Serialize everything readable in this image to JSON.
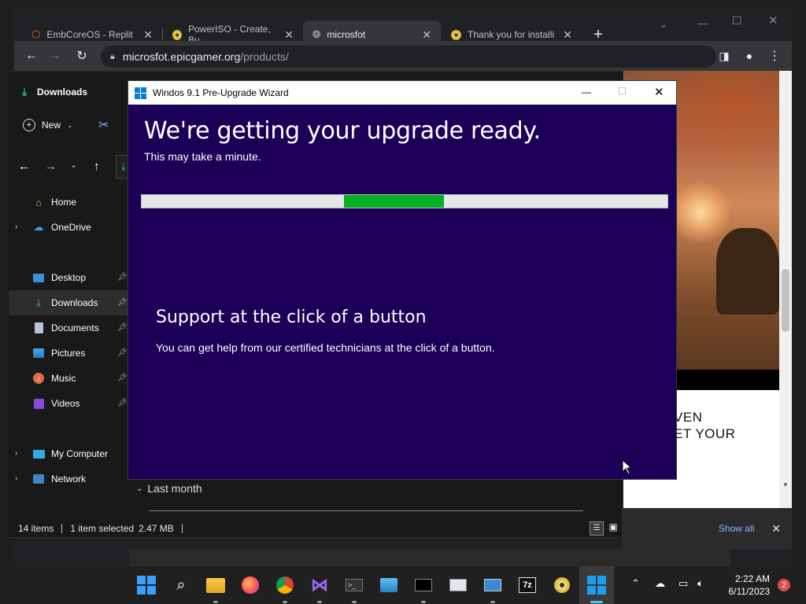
{
  "browser": {
    "tabs": [
      {
        "label": "EmbCoreOS - Replit",
        "icon": "replit-icon"
      },
      {
        "label": "PowerISO - Create, Bu",
        "icon": "poweriso-icon"
      },
      {
        "label": "microsfot",
        "icon": "globe-icon"
      },
      {
        "label": "Thank you for installi",
        "icon": "poweriso-icon"
      }
    ],
    "active_tab_index": 2,
    "new_tab_symbol": "+",
    "url_domain": "microsfot.epicgamer.org",
    "url_path": "/products/",
    "page_text_line1": "VEN",
    "page_text_line2": "ET YOUR"
  },
  "explorer": {
    "header_title": "Downloads",
    "new_label": "New",
    "nav": [
      {
        "label": "Home",
        "icon": "home-icon",
        "expandable": false,
        "pinned": false
      },
      {
        "label": "OneDrive",
        "icon": "cloud-icon",
        "expandable": true,
        "pinned": false
      },
      {
        "label": "Desktop",
        "icon": "desktop-icon",
        "expandable": false,
        "pinned": true
      },
      {
        "label": "Downloads",
        "icon": "download-icon",
        "expandable": false,
        "pinned": true,
        "selected": true
      },
      {
        "label": "Documents",
        "icon": "document-icon",
        "expandable": false,
        "pinned": true
      },
      {
        "label": "Pictures",
        "icon": "picture-icon",
        "expandable": false,
        "pinned": true
      },
      {
        "label": "Music",
        "icon": "music-icon",
        "expandable": false,
        "pinned": true
      },
      {
        "label": "Videos",
        "icon": "video-icon",
        "expandable": false,
        "pinned": true
      },
      {
        "label": "My Computer",
        "icon": "computer-icon",
        "expandable": true,
        "pinned": false
      },
      {
        "label": "Network",
        "icon": "network-icon",
        "expandable": true,
        "pinned": false
      }
    ],
    "group_label": "Last month",
    "status_items": "14 items",
    "status_selected": "1 item selected",
    "status_size": "2.47 MB"
  },
  "downloads_bar": {
    "show_all": "Show all"
  },
  "wizard": {
    "title": "Windos 9.1 Pre-Upgrade Wizard",
    "heading": "We're getting your upgrade ready.",
    "subheading": "This may take a minute.",
    "progress": {
      "start": 0.385,
      "end": 0.575
    },
    "support_heading": "Support at the click of a button",
    "support_text": "You can get help from our certified technicians at the click of a button."
  },
  "taskbar": {
    "apps": [
      "start-icon",
      "search-icon",
      "file-explorer-icon",
      "firefox-icon",
      "chrome-icon",
      "visual-studio-icon",
      "terminal-icon",
      "control-panel-icon",
      "command-prompt-icon",
      "performance-monitor-icon",
      "remote-desktop-icon",
      "7zip-icon",
      "poweriso-icon",
      "start-icon"
    ],
    "time": "2:22 AM",
    "date": "6/11/2023",
    "notification_count": "2"
  },
  "colors": {
    "wizard_bg": "#1c0058",
    "progress_fill": "#06b025",
    "link_blue": "#8ab4f8"
  }
}
